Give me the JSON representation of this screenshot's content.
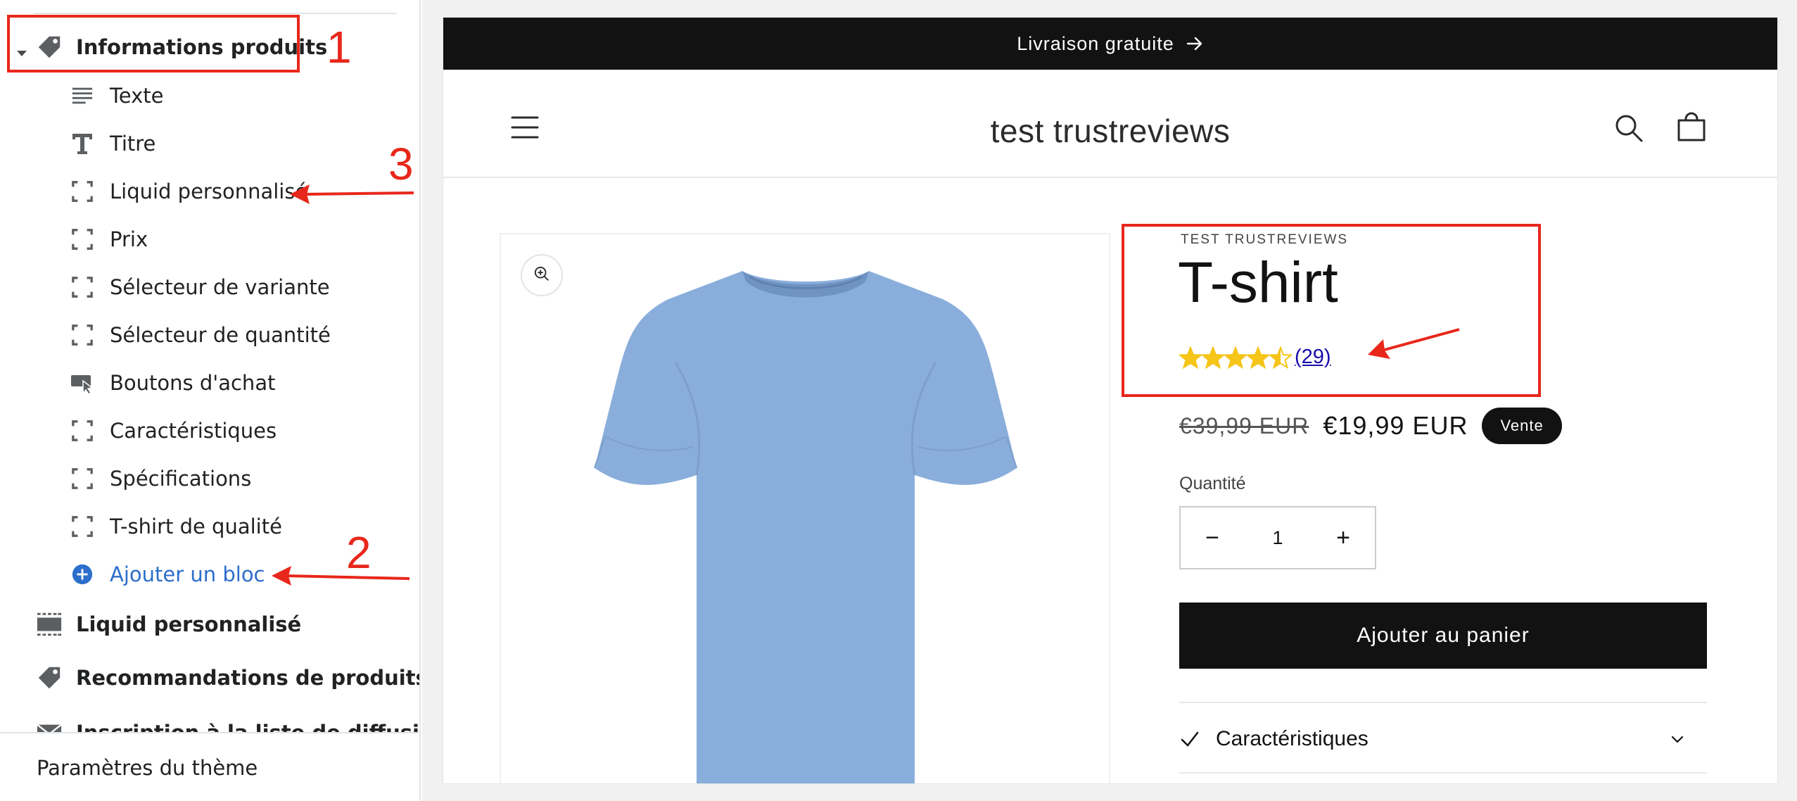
{
  "sidebar": {
    "section_title": "Informations produits",
    "blocks": [
      {
        "label": "Texte",
        "icon": "text-lines-icon"
      },
      {
        "label": "Titre",
        "icon": "title-t-icon"
      },
      {
        "label": "Liquid personnalisé",
        "icon": "dashed-square-icon"
      },
      {
        "label": "Prix",
        "icon": "dashed-square-icon"
      },
      {
        "label": "Sélecteur de variante",
        "icon": "dashed-square-icon"
      },
      {
        "label": "Sélecteur de quantité",
        "icon": "dashed-square-icon"
      },
      {
        "label": "Boutons d'achat",
        "icon": "buy-button-icon"
      },
      {
        "label": "Caractéristiques",
        "icon": "dashed-square-icon"
      },
      {
        "label": "Spécifications",
        "icon": "dashed-square-icon"
      },
      {
        "label": "T-shirt de qualité",
        "icon": "dashed-square-icon"
      }
    ],
    "add_block": "Ajouter un bloc",
    "sections": [
      {
        "label": "Liquid personnalisé",
        "icon": "section-dashed-icon"
      },
      {
        "label": "Recommandations de produits",
        "icon": "tag-icon"
      },
      {
        "label": "Inscription à la liste de diffusion",
        "icon": "mail-icon"
      }
    ],
    "footer": "Paramètres du thème"
  },
  "annotations": {
    "n1": "1",
    "n2": "2",
    "n3": "3",
    "color": "#e8271b"
  },
  "store": {
    "announcement": "Livraison gratuite",
    "name": "test trustreviews"
  },
  "product": {
    "vendor": "TEST TRUSTREVIEWS",
    "title": "T-shirt",
    "rating_value": 4.5,
    "rating_max": 5,
    "rating_count": "(29)",
    "price_old": "€39,99 EUR",
    "price_new": "€19,99 EUR",
    "sale_badge": "Vente",
    "quantity_label": "Quantité",
    "quantity_value": "1",
    "quantity_minus": "−",
    "quantity_plus": "+",
    "add_to_cart": "Ajouter au panier",
    "accordion_label": "Caractéristiques"
  },
  "colors": {
    "accent_blue": "#2c6ecb",
    "star": "#f5c518",
    "dark": "#121212",
    "shirt": "#8aaedb"
  }
}
